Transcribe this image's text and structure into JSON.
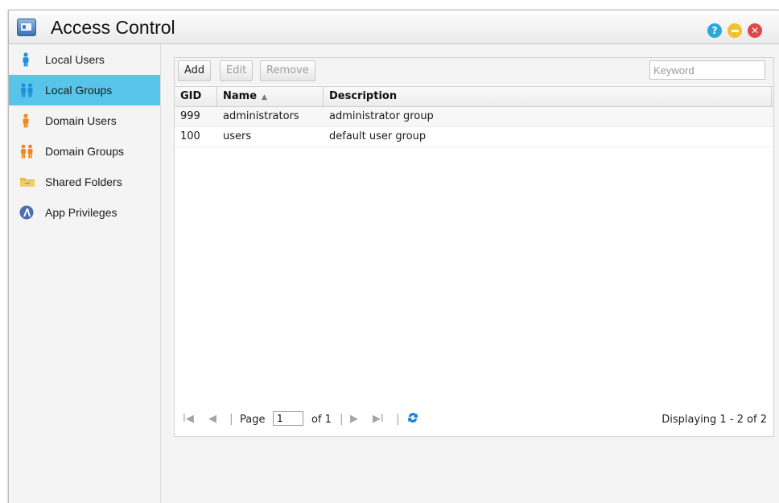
{
  "window": {
    "title": "Access Control"
  },
  "title_buttons": {
    "help": "?",
    "minimize": "",
    "close": "✕"
  },
  "sidebar": {
    "items": [
      {
        "label": "Local Users",
        "icon": "user-icon",
        "color": "#1e90d8",
        "active": false
      },
      {
        "label": "Local Groups",
        "icon": "group-icon",
        "color": "#1e90d8",
        "active": true
      },
      {
        "label": "Domain Users",
        "icon": "domain-user-icon",
        "color": "#f08a1c",
        "active": false
      },
      {
        "label": "Domain Groups",
        "icon": "domain-group-icon",
        "color": "#f08a1c",
        "active": false
      },
      {
        "label": "Shared Folders",
        "icon": "folder-icon",
        "color": "#e8b84a",
        "active": false
      },
      {
        "label": "App Privileges",
        "icon": "app-privileges-icon",
        "color": "#4a6fb5",
        "active": false
      }
    ]
  },
  "toolbar": {
    "add_label": "Add",
    "edit_label": "Edit",
    "remove_label": "Remove",
    "search_placeholder": "Keyword"
  },
  "table": {
    "columns": [
      "GID",
      "Name",
      "Description"
    ],
    "sort_indicator": "▲",
    "rows": [
      [
        "999",
        "administrators",
        "administrator group"
      ],
      [
        "100",
        "users",
        "default user group"
      ]
    ]
  },
  "pager": {
    "first": "I◀",
    "prev": "◀",
    "page_label": "Page",
    "page_value": "1",
    "of_label": "of 1",
    "next": "▶",
    "last": "▶I",
    "displaying": "Displaying 1 - 2 of 2"
  },
  "colors": {
    "active_nav": "#59c4ea",
    "accent_blue": "#1e90d8",
    "accent_orange": "#f08a1c"
  }
}
